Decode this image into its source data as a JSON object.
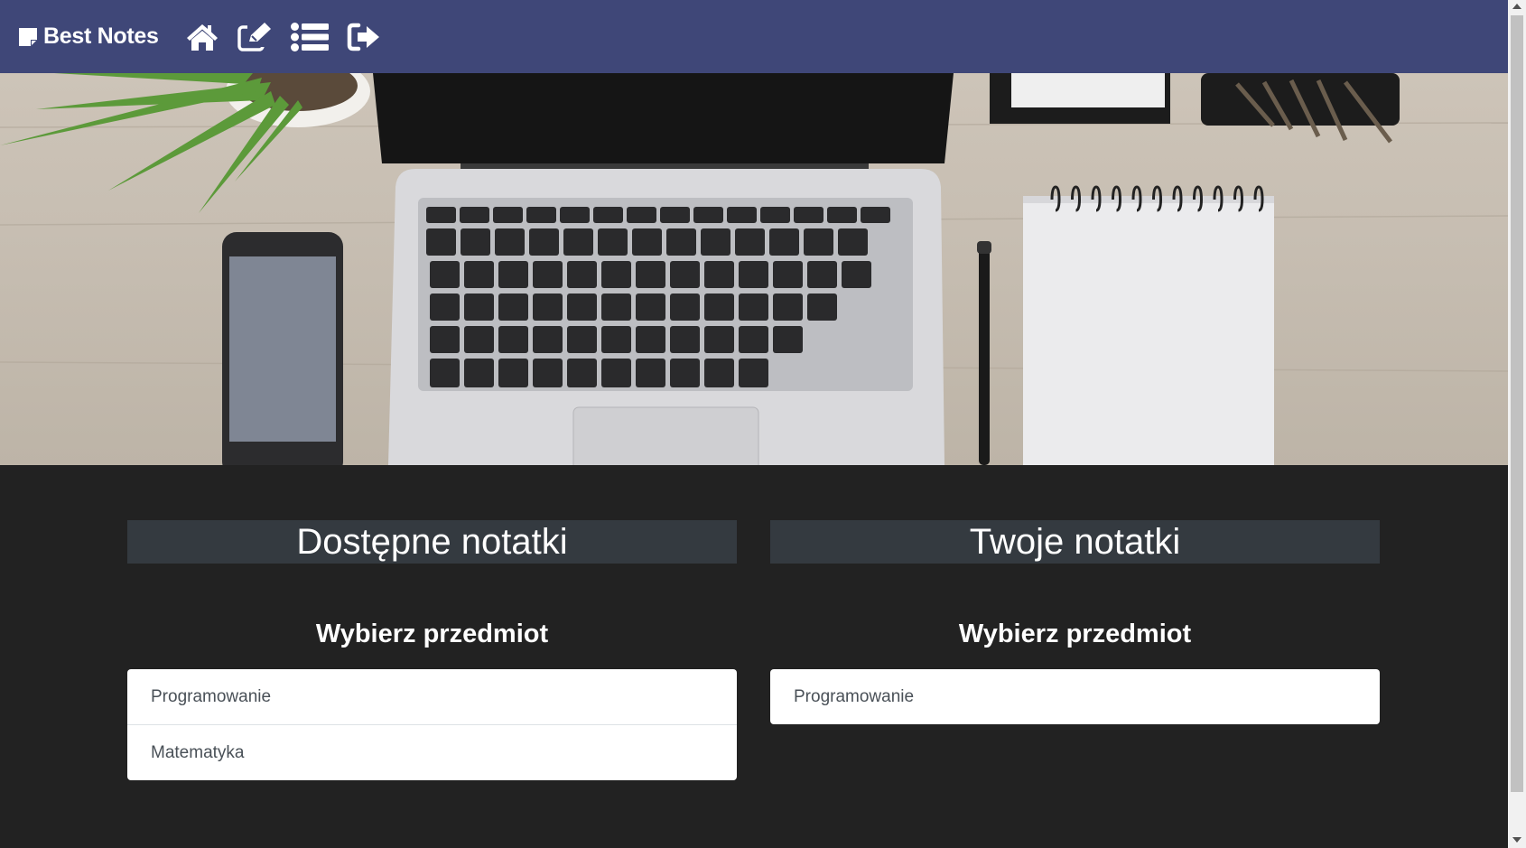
{
  "navbar": {
    "brand": "Best Notes",
    "brand_icon": "sticky-note-icon",
    "links": [
      {
        "icon": "home-icon"
      },
      {
        "icon": "edit-note-icon"
      },
      {
        "icon": "list-icon"
      },
      {
        "icon": "sign-out-icon"
      }
    ],
    "background": "#3f4778"
  },
  "hero": {
    "image": "desk-laptop-notebook-photo"
  },
  "available_notes": {
    "title": "Dostępne notatki",
    "subtitle": "Wybierz przedmiot",
    "subjects": [
      {
        "label": "Programowanie"
      },
      {
        "label": "Matematyka"
      }
    ]
  },
  "your_notes": {
    "title": "Twoje notatki",
    "subtitle": "Wybierz przedmiot",
    "subjects": [
      {
        "label": "Programowanie"
      }
    ]
  },
  "colors": {
    "page_background": "#222222",
    "panel_header": "#343a40",
    "list_background": "#ffffff"
  }
}
